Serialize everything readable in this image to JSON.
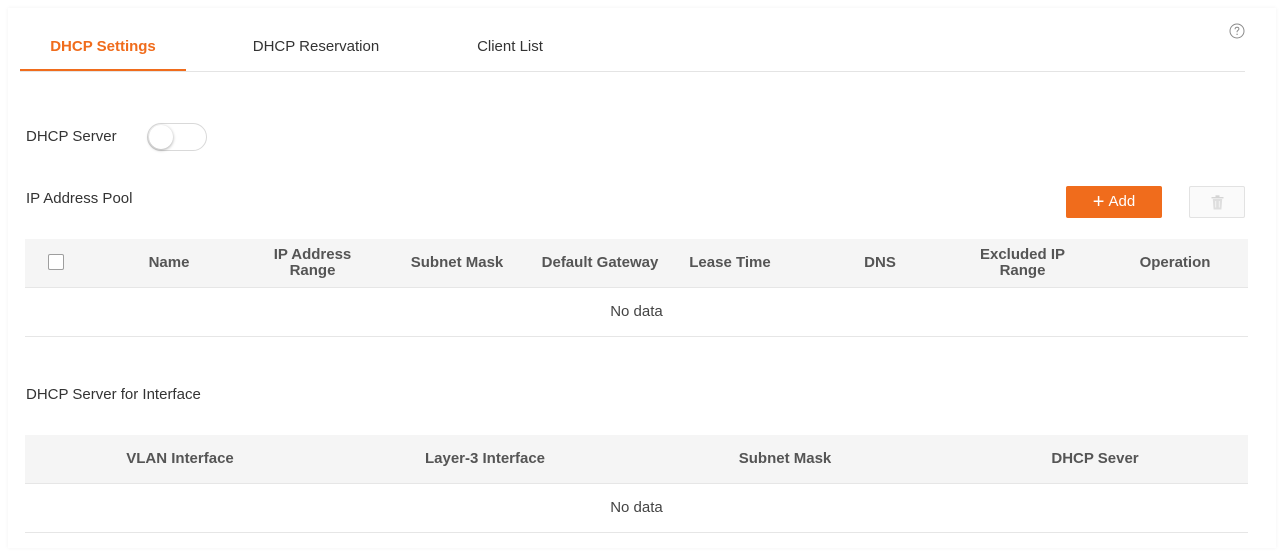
{
  "tabs": [
    {
      "label": "DHCP Settings",
      "active": true
    },
    {
      "label": "DHCP Reservation",
      "active": false
    },
    {
      "label": "Client List",
      "active": false
    }
  ],
  "help_icon": "question-circle-icon",
  "dhcp_server": {
    "label": "DHCP Server",
    "enabled": false
  },
  "pool": {
    "title": "IP Address Pool",
    "add_label": "Add",
    "add_icon": "plus-icon",
    "delete_icon": "trash-icon",
    "columns": [
      "Name",
      "IP Address Range",
      "Subnet Mask",
      "Default Gateway",
      "Lease Time",
      "DNS",
      "Excluded IP Range",
      "Operation"
    ],
    "empty_text": "No data"
  },
  "interface": {
    "title": "DHCP Server for Interface",
    "columns": [
      "VLAN Interface",
      "Layer-3 Interface",
      "Subnet Mask",
      "DHCP Sever"
    ],
    "empty_text": "No data"
  },
  "colors": {
    "accent": "#f06c1c",
    "header_bg": "#f5f5f5",
    "border": "#e6e6e6"
  }
}
